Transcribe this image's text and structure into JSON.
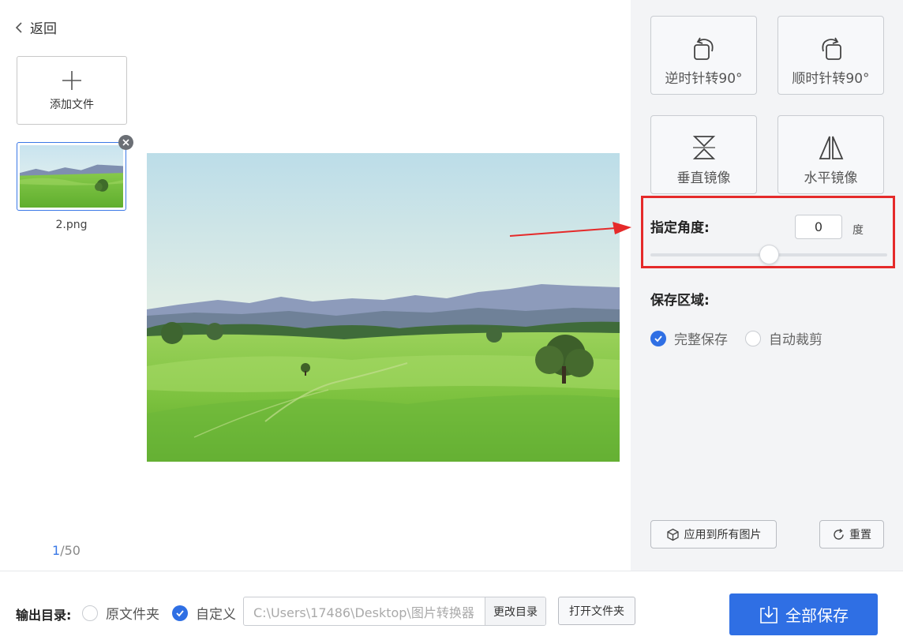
{
  "nav": {
    "back_label": "返回"
  },
  "files": {
    "add_label": "添加文件",
    "items": [
      {
        "name": "2.png"
      }
    ],
    "pager": {
      "current": "1",
      "total": "/50"
    }
  },
  "tools": {
    "rotate_ccw": "逆时针转90°",
    "rotate_cw": "顺时针转90°",
    "flip_vertical": "垂直镜像",
    "flip_horizontal": "水平镜像"
  },
  "angle": {
    "label": "指定角度:",
    "value": "0",
    "unit": "度"
  },
  "save_area": {
    "label": "保存区域:",
    "options": [
      "完整保存",
      "自动裁剪"
    ],
    "selected": "完整保存"
  },
  "actions": {
    "apply_all": "应用到所有图片",
    "reset": "重置"
  },
  "output": {
    "label": "输出目录:",
    "options": [
      "原文件夹",
      "自定义"
    ],
    "selected": "自定义",
    "path": "C:\\Users\\17486\\Desktop\\图片转换器",
    "change_label": "更改目录",
    "open_label": "打开文件夹",
    "save_all_label": "全部保存"
  },
  "colors": {
    "accent": "#2f6fe4",
    "highlight": "#e52a2a",
    "panel_bg": "#f3f4f6"
  }
}
